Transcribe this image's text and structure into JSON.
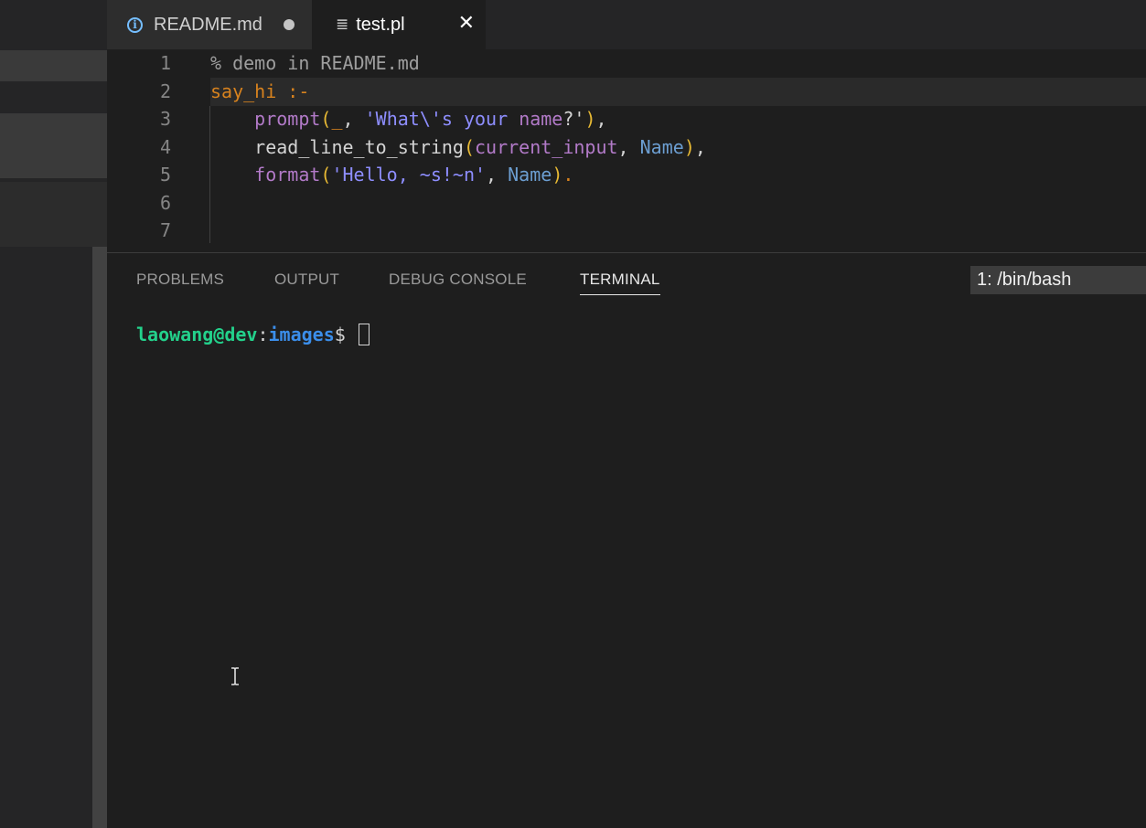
{
  "tabs": [
    {
      "label": "README.md",
      "icon": "info-icon",
      "dirty": true
    },
    {
      "label": "test.pl",
      "icon": "lines-icon",
      "close_symbol": "✕"
    }
  ],
  "editor": {
    "lines": [
      {
        "num": "1",
        "comment": "% demo in README.md"
      },
      {
        "num": "2",
        "head": "say_hi",
        "neck": ":-"
      },
      {
        "num": "3",
        "indent": "    ",
        "pred": "prompt",
        "open": "(",
        "arg1": "_",
        "sep1": ", ",
        "arg2a": "'What\\'s your ",
        "arg2b": "name",
        "arg2c": "?'",
        "close": ")",
        "end": ","
      },
      {
        "num": "4",
        "indent": "    ",
        "pred": "read_line_to_string",
        "open": "(",
        "arg1": "current_input",
        "sep1": ", ",
        "arg2": "Name",
        "close": ")",
        "end": ","
      },
      {
        "num": "5",
        "indent": "    ",
        "pred": "format",
        "open": "(",
        "arg1": "'Hello, ~s!~n'",
        "sep1": ", ",
        "arg2": "Name",
        "close": ")",
        "end": "."
      },
      {
        "num": "6"
      },
      {
        "num": "7"
      }
    ]
  },
  "panel": {
    "tabs": [
      "PROBLEMS",
      "OUTPUT",
      "DEBUG CONSOLE",
      "TERMINAL"
    ],
    "active_tab": "TERMINAL",
    "terminal_select": "1: /bin/bash",
    "prompt": {
      "user_host": "laowang@dev",
      "colon": ":",
      "dir": "images",
      "dollar": "$ "
    }
  },
  "colors": {
    "accent_blue": "#75beff",
    "terminal_green": "#23d18b",
    "terminal_blue": "#3b8eea"
  }
}
